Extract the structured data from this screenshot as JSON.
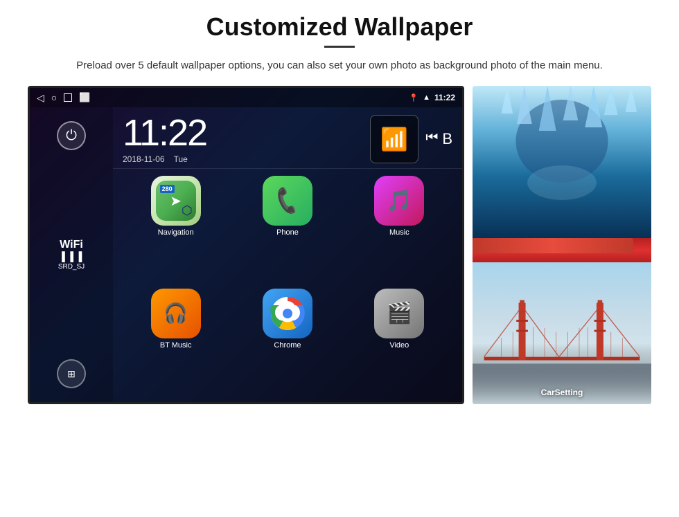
{
  "page": {
    "title": "Customized Wallpaper",
    "subtitle": "Preload over 5 default wallpaper options, you can also set your own photo as background photo of the main menu."
  },
  "android": {
    "statusBar": {
      "time": "11:22",
      "icons": [
        "nav-back",
        "home",
        "recent",
        "screenshot",
        "location",
        "wifi",
        "signal"
      ]
    },
    "clock": {
      "time": "11:22",
      "date": "2018-11-06",
      "day": "Tue"
    },
    "sidebar": {
      "powerLabel": "⏻",
      "wifi": {
        "label": "WiFi",
        "ssid": "SRD_SJ"
      },
      "gridLabel": "⊞"
    },
    "apps": [
      {
        "id": "navigation",
        "label": "Navigation",
        "icon": "map"
      },
      {
        "id": "phone",
        "label": "Phone",
        "icon": "phone"
      },
      {
        "id": "music",
        "label": "Music",
        "icon": "music"
      },
      {
        "id": "bt-music",
        "label": "BT Music",
        "icon": "bluetooth"
      },
      {
        "id": "chrome",
        "label": "Chrome",
        "icon": "chrome"
      },
      {
        "id": "video",
        "label": "Video",
        "icon": "video"
      }
    ],
    "mapBadge": "280"
  },
  "wallpapers": {
    "top": {
      "description": "Ice cave / blue glacial scene"
    },
    "mid": {
      "description": "Red stripe separator"
    },
    "bottom": {
      "description": "Golden Gate Bridge in fog",
      "label": "CarSetting"
    }
  }
}
